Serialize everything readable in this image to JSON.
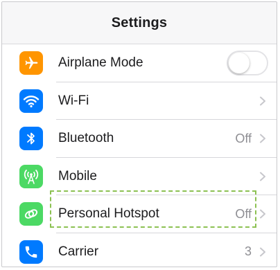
{
  "nav": {
    "title": "Settings"
  },
  "rows": [
    {
      "label": "Airplane Mode",
      "icon": "airplane-icon",
      "icon_color": "#ff9500",
      "value": "",
      "control": "toggle",
      "toggle_on": false
    },
    {
      "label": "Wi-Fi",
      "icon": "wifi-icon",
      "icon_color": "#007aff",
      "value": "",
      "control": "chevron"
    },
    {
      "label": "Bluetooth",
      "icon": "bluetooth-icon",
      "icon_color": "#007aff",
      "value": "Off",
      "control": "chevron"
    },
    {
      "label": "Mobile",
      "icon": "antenna-icon",
      "icon_color": "#4cd964",
      "value": "",
      "control": "chevron"
    },
    {
      "label": "Personal Hotspot",
      "icon": "hotspot-link-icon",
      "icon_color": "#4cd964",
      "value": "Off",
      "control": "chevron",
      "highlighted": true
    },
    {
      "label": "Carrier",
      "icon": "phone-icon",
      "icon_color": "#007aff",
      "value": "3",
      "control": "chevron"
    }
  ],
  "colors": {
    "highlight_border": "#8cc152",
    "secondary_text": "#8e8e93"
  }
}
